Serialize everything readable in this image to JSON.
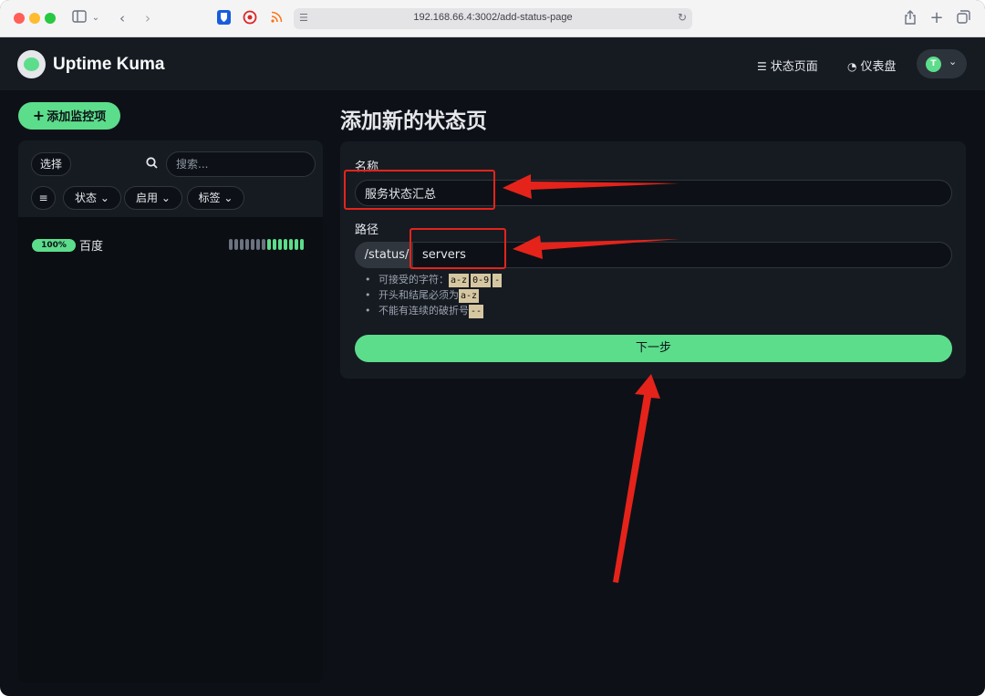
{
  "browser": {
    "url": "192.168.66.4:3002/add-status-page"
  },
  "header": {
    "app_title": "Uptime Kuma",
    "nav": [
      {
        "label": "状态页面",
        "icon": "list-icon"
      },
      {
        "label": "仪表盘",
        "icon": "dashboard-gauge-icon"
      }
    ],
    "avatar_initial": "T"
  },
  "sidebar": {
    "add_button": "添加监控项",
    "select_button": "选择",
    "search_placeholder": "搜索...",
    "filters": [
      "状态",
      "启用",
      "标签"
    ],
    "monitors": [
      {
        "name": "百度",
        "uptime": "100%",
        "heartbeats": [
          "empty",
          "empty",
          "empty",
          "empty",
          "empty",
          "empty",
          "empty",
          "up",
          "up",
          "up",
          "up",
          "up",
          "up",
          "up"
        ]
      }
    ]
  },
  "main": {
    "title": "添加新的状态页",
    "name_label": "名称",
    "name_value": "服务状态汇总",
    "path_label": "路径",
    "path_prefix": "/status/",
    "path_value": "servers",
    "hints": [
      {
        "text": "可接受的字符：",
        "codes": [
          "a-z",
          "0-9",
          "-"
        ]
      },
      {
        "text": "开头和结尾必须为",
        "codes": [
          "a-z"
        ]
      },
      {
        "text": "不能有连续的破折号",
        "codes": [
          "--"
        ]
      }
    ],
    "next_button": "下一步"
  },
  "colors": {
    "accent": "#5cdd8b",
    "background": "#0d1117",
    "card": "#161b22",
    "annotation": "#e5231b"
  }
}
